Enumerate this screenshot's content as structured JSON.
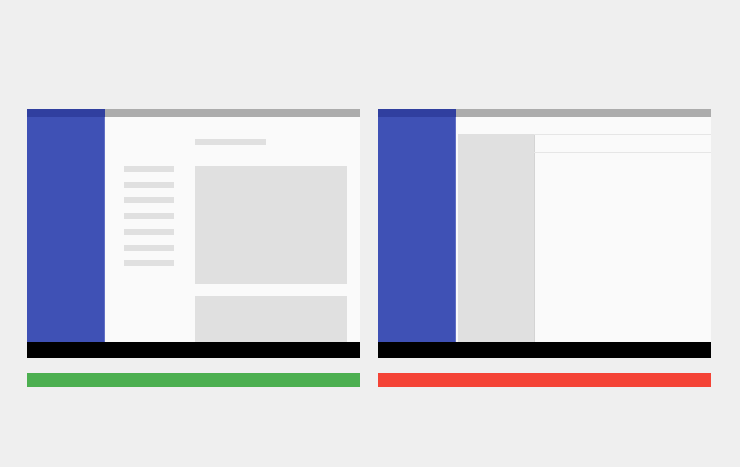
{
  "colors": {
    "background": "#efefef",
    "sidebar": "#3f51b5",
    "sidebar_top": "#303f9f",
    "topbar": "#acacac",
    "surface": "#fafafa",
    "placeholder": "#e0e0e0",
    "bottom_bar": "#000000",
    "good_indicator": "#4caf50",
    "bad_indicator": "#f44336"
  },
  "good_layout": {
    "nav_line_count": 7,
    "indicator": "correct"
  },
  "bad_layout": {
    "indicator": "incorrect"
  }
}
